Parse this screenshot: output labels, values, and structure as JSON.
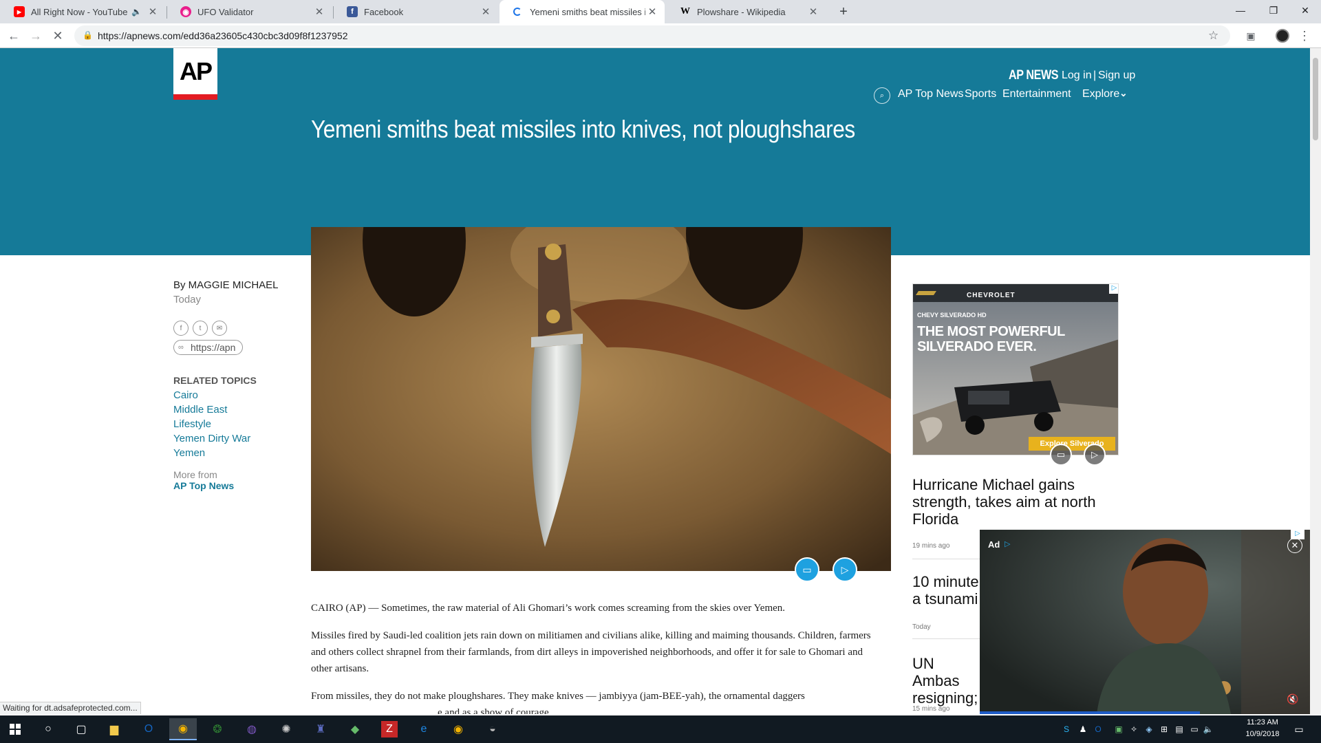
{
  "browser": {
    "tabs": [
      {
        "title": "All Right Now - YouTube",
        "icon": "youtube-icon",
        "color": "#ff0000",
        "muted": true
      },
      {
        "title": "UFO Validator",
        "icon": "ufo-icon",
        "color": "#e91e8c"
      },
      {
        "title": "Facebook",
        "icon": "facebook-icon",
        "color": "#3b5998"
      },
      {
        "title": "Yemeni smiths beat missiles into",
        "icon": "loading-spinner-icon",
        "color": "#1a73e8",
        "active": true
      },
      {
        "title": "Plowshare - Wikipedia",
        "icon": "wikipedia-icon",
        "color": "#000000"
      }
    ],
    "new_tab": "+",
    "url": "https://apnews.com/edd36a23605c430cbc3d09f8f1237952",
    "status_text": "Waiting for dt.adsafeprotected.com..."
  },
  "site": {
    "logo": "AP",
    "brand": "AP NEWS",
    "login": "Log in",
    "separator": "|",
    "signup": "Sign up",
    "nav": [
      "AP Top News",
      "Sports",
      "Entertainment",
      "Explore"
    ],
    "colors": {
      "hero": "#157a98",
      "logo_red": "#e31c23",
      "link": "#157a98"
    }
  },
  "article": {
    "headline": "Yemeni smiths beat missiles into knives, not ploughshares",
    "byline": "By MAGGIE MICHAEL",
    "date": "Today",
    "share_url": "https://apn",
    "related_heading": "RELATED TOPICS",
    "topics": [
      "Cairo",
      "Middle East",
      "Lifestyle",
      "Yemen Dirty War",
      "Yemen"
    ],
    "more_from": "More from",
    "more_from_link": "AP Top News",
    "paragraphs": [
      "CAIRO (AP) — Sometimes, the raw material of Ali Ghomari’s work comes screaming from the skies over Yemen.",
      "Missiles fired by Saudi-led coalition jets rain down on militiamen and civilians alike, killing and maiming thousands. Children, farmers and others collect shrapnel from their farmlands, from dirt alleys in impoverished neighborhoods, and offer it for sale to Ghomari and other artisans.",
      "From missiles, they do not make ploughshares. They make knives — jambiyya (jam-BEE-yah), the ornamental daggers",
      "e and as a show of courage."
    ]
  },
  "ad": {
    "brand": "CHEVROLET",
    "model": "CHEVY SILVERADO HD",
    "tagline_1": "THE MOST POWERFUL",
    "tagline_2": "SILVERADO EVER.",
    "cta": "Explore Silverado",
    "video_label": "Ad"
  },
  "rail": [
    {
      "headline": "Hurricane Michael gains strength, takes aim at north Florida",
      "time": "19 mins ago"
    },
    {
      "headline": "10 minute a tsunami",
      "time": "Today"
    },
    {
      "headline": "UN Ambas resigning;",
      "time": "15 mins ago"
    }
  ],
  "taskbar": {
    "time": "11:23 AM",
    "date": "10/9/2018"
  }
}
